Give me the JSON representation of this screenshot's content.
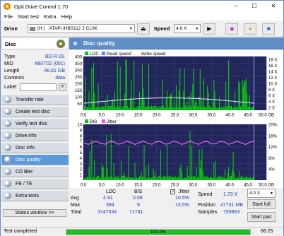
{
  "app": {
    "title": "Opti Drive Control 1.70",
    "controls": {
      "minimize": "─",
      "maximize": "☐",
      "close": "✕"
    }
  },
  "menu": [
    "File",
    "Start test",
    "Extra",
    "Help"
  ],
  "toolbar": {
    "drive_label": "Drive",
    "drive_letter": "(H:)",
    "drive_name": "ATAPI iHBS112  2 CL0K",
    "speed_label": "Speed",
    "speed_value": "4.0 X",
    "icons": [
      "eject-icon",
      "erase-icon",
      "copy-icon",
      "save-icon"
    ]
  },
  "disc": {
    "header": "Disc",
    "fields": [
      {
        "key": "Type",
        "value": "BD-R DL"
      },
      {
        "key": "MID",
        "value": "MEIT02 (001)"
      },
      {
        "key": "Length",
        "value": "46.61 GB"
      },
      {
        "key": "Contents",
        "value": "data"
      },
      {
        "key": "Label",
        "value": ""
      }
    ]
  },
  "nav": [
    {
      "label": "Transfer rate",
      "active": false
    },
    {
      "label": "Create test disc",
      "active": false
    },
    {
      "label": "Verify test disc",
      "active": false
    },
    {
      "label": "Drive info",
      "active": false
    },
    {
      "label": "Disc info",
      "active": false
    },
    {
      "label": "Disc quality",
      "active": true
    },
    {
      "label": "CD Bler",
      "active": false
    },
    {
      "label": "FE / TE",
      "active": false
    },
    {
      "label": "Extra tests",
      "active": false
    }
  ],
  "status_window_btn": "Status window >>",
  "panel": {
    "title": "Disc quality"
  },
  "chart_data": [
    {
      "type": "bar",
      "legend": [
        "LDC",
        "Read speed",
        "Write speed"
      ],
      "legend_colors": [
        "#00cc00",
        "#6080ff",
        "#ffffff"
      ],
      "x_ticks": [
        "0.0",
        "5.0",
        "10.0",
        "15.0",
        "20.0",
        "25.0",
        "30.0",
        "35.0",
        "40.0",
        "45.0",
        "50.0 GB"
      ],
      "y_left_ticks": [
        "400",
        "350",
        "300",
        "250",
        "200",
        "150",
        "100",
        "50"
      ],
      "y_right_ticks": [
        "18 X",
        "16 X",
        "14 X",
        "12 X",
        "10 X",
        "8 X",
        "6 X",
        "4 X",
        "2 X"
      ],
      "xlim": [
        0,
        50
      ],
      "ylim": [
        0,
        400
      ],
      "avg": 4.91,
      "max": 394,
      "end_marker_gb": 46.61
    },
    {
      "type": "bar",
      "legend": [
        "BIS",
        "Jitter"
      ],
      "legend_colors": [
        "#00cc00",
        "#ff40ff"
      ],
      "x_ticks": [
        "0.0",
        "5.0",
        "10.0",
        "15.0",
        "20.0",
        "25.0",
        "30.0",
        "35.0",
        "40.0",
        "45.0",
        "50.0 GB"
      ],
      "y_left_ticks": [
        "10",
        "9",
        "8",
        "7",
        "6",
        "5",
        "4",
        "3",
        "2",
        "1"
      ],
      "y_right_ticks": [
        "20%",
        "16%",
        "12%",
        "8%",
        "4%"
      ],
      "xlim": [
        0,
        50
      ],
      "ylim": [
        0,
        10
      ],
      "avg": 0.09,
      "max": 9,
      "jitter_avg": 10.5,
      "jitter_max": 13.5
    }
  ],
  "stats": {
    "col_ldc": "LDC",
    "col_bis": "BIS",
    "rows": [
      {
        "label": "Avg",
        "ldc": "4.91",
        "bis": "0.09",
        "jitter": "10.5%"
      },
      {
        "label": "Max",
        "ldc": "394",
        "bis": "9",
        "jitter": "13.5%"
      },
      {
        "label": "Total",
        "ldc": "3747634",
        "bis": "71741",
        "jitter": ""
      }
    ],
    "jitter_label": "Jitter",
    "jitter_checked": true,
    "speed_label": "Speed",
    "speed_value": "1.73 X",
    "speed_select": "4.0 X",
    "position_label": "Position",
    "position_value": "47731 MB",
    "samples_label": "Samples",
    "samples_value": "759963",
    "start_full": "Start full",
    "start_part": "Start part"
  },
  "statusbar": {
    "text": "Test completed",
    "progress": 100,
    "progress_text": "100.0%",
    "time": "66:25"
  }
}
